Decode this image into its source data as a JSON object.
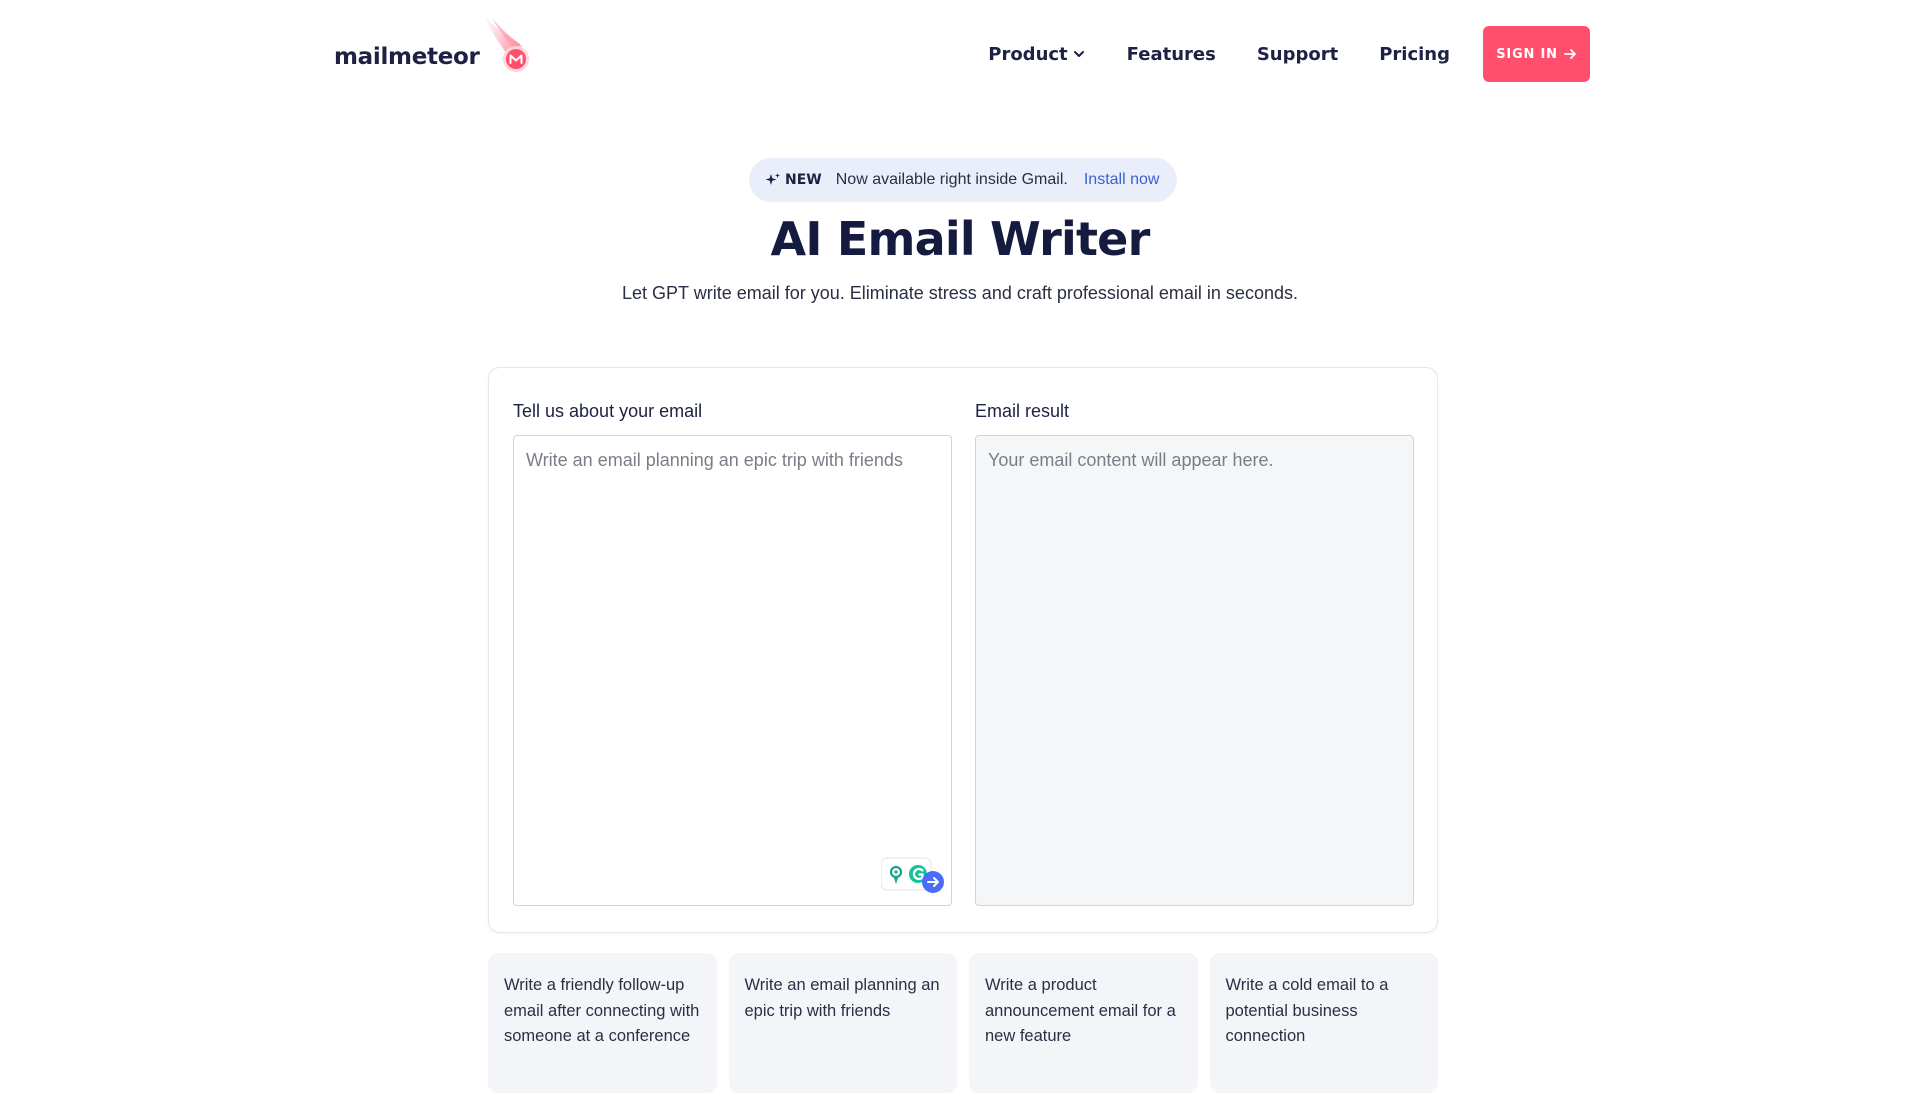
{
  "brand": {
    "name": "mailmeteor",
    "accent": "#ff4f6d",
    "text_color": "#1d2144",
    "link_color": "#3d5fd4"
  },
  "nav": {
    "items": [
      {
        "label": "Product",
        "has_dropdown": true
      },
      {
        "label": "Features"
      },
      {
        "label": "Support"
      },
      {
        "label": "Pricing"
      }
    ],
    "signin_label": "SIGN IN"
  },
  "announcement": {
    "badge": "NEW",
    "text": "Now available right inside Gmail.",
    "link": "Install now"
  },
  "hero": {
    "title": "AI Email Writer",
    "subtitle": "Let GPT write email for you. Eliminate stress and craft professional email in seconds."
  },
  "form": {
    "input_label": "Tell us about your email",
    "input_placeholder": "Write an email planning an epic trip with friends",
    "result_label": "Email result",
    "result_placeholder": "Your email content will appear here."
  },
  "suggestions": [
    "Write a friendly follow-up email after connecting with someone at a conference",
    "Write an email planning an epic trip with friends",
    "Write a product announcement email for a new feature",
    "Write a cold email to a potential business connection"
  ]
}
